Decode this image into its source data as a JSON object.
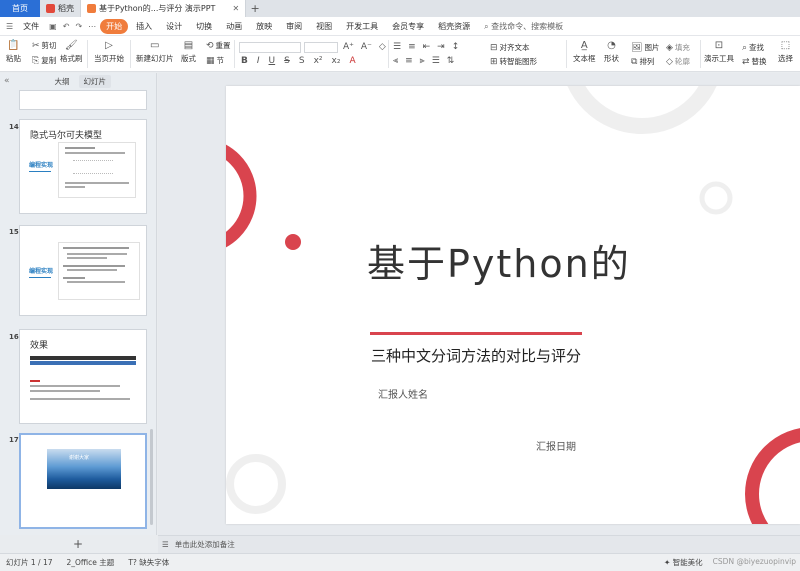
{
  "titlebar": {
    "home": "首页",
    "tabs": [
      {
        "label": "稻壳",
        "color": "#e2493b"
      },
      {
        "label": "基于Python的...与评分 演示PPT",
        "color": "#f07c3c"
      }
    ]
  },
  "menu": {
    "file": "文件",
    "items": [
      "开始",
      "插入",
      "设计",
      "切换",
      "动画",
      "放映",
      "审阅",
      "视图",
      "开发工具",
      "会员专享",
      "稻壳资源"
    ],
    "search": "查找命令、搜索模板"
  },
  "ribbon": {
    "paste": "粘贴",
    "cut": "剪切",
    "copy": "复制",
    "format_painter": "格式刷",
    "from_current": "当页开始",
    "new_slide": "新建幻灯片",
    "layout": "版式",
    "section": "节",
    "reset": "重置",
    "align_text": "对齐文本",
    "convert_smartart": "转智能图形",
    "textbox": "文本框",
    "shape": "形状",
    "picture": "图片",
    "arrange": "排列",
    "fill": "填充",
    "outline": "轮廓",
    "presentation_tools": "演示工具",
    "find": "查找",
    "replace": "替换",
    "select": "选择"
  },
  "leftpanel": {
    "tab_outline": "大纲",
    "tab_slides": "幻灯片",
    "slides": [
      {
        "num": "14",
        "title": "隐式马尔可夫模型",
        "section": "编程实现"
      },
      {
        "num": "15",
        "title": "",
        "section": "编程实现"
      },
      {
        "num": "16",
        "title": "效果"
      },
      {
        "num": "17",
        "banner": "谢谢大家"
      }
    ]
  },
  "slide": {
    "title": "基于Python的",
    "subtitle": "三种中文分词方法的对比与评分",
    "reporter": "汇报人姓名",
    "date": "汇报日期",
    "colors": {
      "accent": "#d9444e",
      "ring": "#eeeeee"
    }
  },
  "notes": {
    "placeholder": "单击此处添加备注"
  },
  "status": {
    "slide_pos": "幻灯片 1 / 17",
    "theme": "2_Office 主题",
    "missing_font": "缺失字体",
    "smart_beautify": "智能美化",
    "watermark": "CSDN @biyezuopinvip"
  }
}
